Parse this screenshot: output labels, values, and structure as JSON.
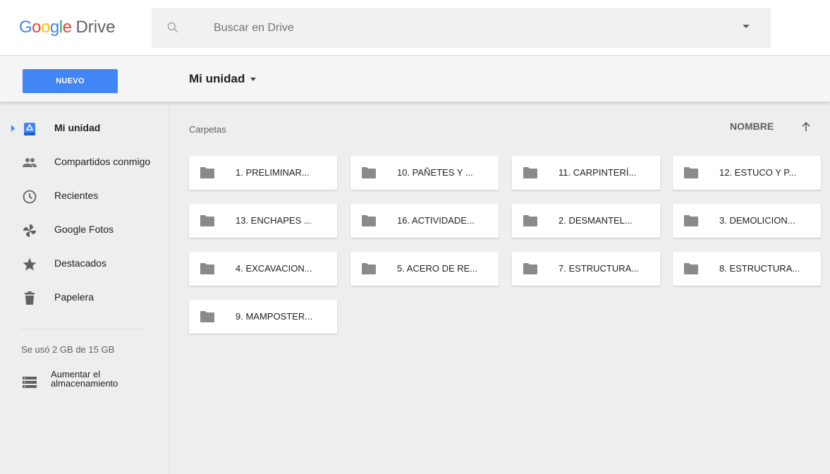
{
  "app": {
    "logo_letters": [
      "G",
      "o",
      "o",
      "g",
      "l",
      "e"
    ],
    "logo_product": "Drive"
  },
  "search": {
    "placeholder": "Buscar en Drive",
    "value": ""
  },
  "toolbar": {
    "new_label": "NUEVO",
    "location_label": "Mi unidad"
  },
  "sidebar": {
    "items": [
      {
        "label": "Mi unidad",
        "icon": "my-drive-icon",
        "active": true
      },
      {
        "label": "Compartidos conmigo",
        "icon": "people-icon",
        "active": false
      },
      {
        "label": "Recientes",
        "icon": "clock-icon",
        "active": false
      },
      {
        "label": "Google Fotos",
        "icon": "pinwheel-icon",
        "active": false
      },
      {
        "label": "Destacados",
        "icon": "star-icon",
        "active": false
      },
      {
        "label": "Papelera",
        "icon": "trash-icon",
        "active": false
      }
    ],
    "storage_text": "Se usó 2 GB de 15 GB",
    "upgrade_label": "Aumentar el almacenamiento"
  },
  "main": {
    "section_title": "Carpetas",
    "sort_label": "NOMBRE",
    "folders": [
      "1. PRELIMINAR...",
      "10. PAÑETES Y ...",
      "11. CARPINTERÍ...",
      "12. ESTUCO Y P...",
      "13. ENCHAPES ...",
      "16. ACTIVIDADE...",
      "2. DESMANTEL...",
      "3. DEMOLICION...",
      "4. EXCAVACION...",
      "5. ACERO DE RE...",
      "7. ESTRUCTURA...",
      "8. ESTRUCTURA...",
      "9. MAMPOSTER..."
    ]
  },
  "colors": {
    "accent": "#4285f4",
    "google_red": "#ea4335",
    "google_yellow": "#fbbc05",
    "google_green": "#34a853",
    "icon_gray": "#616161"
  }
}
